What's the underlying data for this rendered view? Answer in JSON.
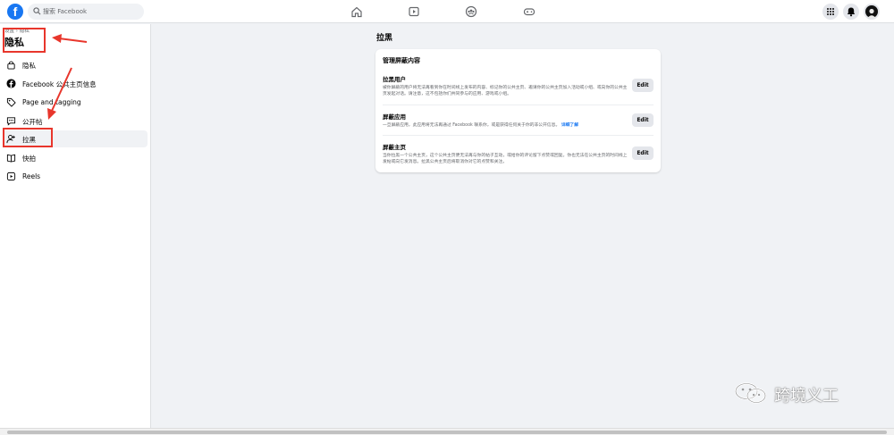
{
  "topbar": {
    "logo_letter": "f",
    "search_placeholder": "搜索 Facebook",
    "nav_icons": [
      "home-icon",
      "watch-icon",
      "groups-icon",
      "gaming-icon"
    ],
    "right_icons": [
      "menu-grid-icon",
      "notifications-icon",
      "avatar"
    ]
  },
  "sidebar": {
    "breadcrumb": "设置 › 隐私",
    "title": "隐私",
    "items": [
      {
        "label": "隐私",
        "icon": "lock-icon"
      },
      {
        "label": "Facebook 公共主页信息",
        "icon": "facebook-icon"
      },
      {
        "label": "Page and tagging",
        "icon": "tag-icon"
      },
      {
        "label": "公开帖",
        "icon": "public-post-icon"
      },
      {
        "label": "拉黑",
        "icon": "block-user-icon",
        "active": true
      },
      {
        "label": "快拍",
        "icon": "stories-icon"
      },
      {
        "label": "Reels",
        "icon": "reels-icon"
      }
    ]
  },
  "main": {
    "title": "拉黑",
    "card": {
      "title": "管理屏蔽内容",
      "rows": [
        {
          "title": "拉黑用户",
          "desc": "被你屏蔽的用户将无法再看到你在时间线上发布的内容、标记你的公共主页、邀请你的公共主页加入活动或小组、或向你的公共主页发起对话。请注意，这不包括你们共同参与的应用、游戏或小组。",
          "more": "",
          "edit": "Edit"
        },
        {
          "title": "屏蔽应用",
          "desc": "一旦屏蔽应用，此应用将无法再通过 Facebook 联系你，或是获得任何关于你的非公开信息。",
          "more": "详细了解",
          "edit": "Edit"
        },
        {
          "title": "屏蔽主页",
          "desc": "当你拉黑一个公共主页，这个公共主页便无法再与你的帖子互动，或给你的评论留下点赞或回复。你也无法在公共主页的时间线上发帖或向它发消息。拉黑公共主页后将取消你对它的点赞和关注。",
          "more": "",
          "edit": "Edit"
        }
      ]
    }
  },
  "watermark": {
    "text": "跨境义工",
    "icon": "wechat-icon"
  },
  "colors": {
    "brand": "#1877f2",
    "annotation": "#e8362c"
  }
}
